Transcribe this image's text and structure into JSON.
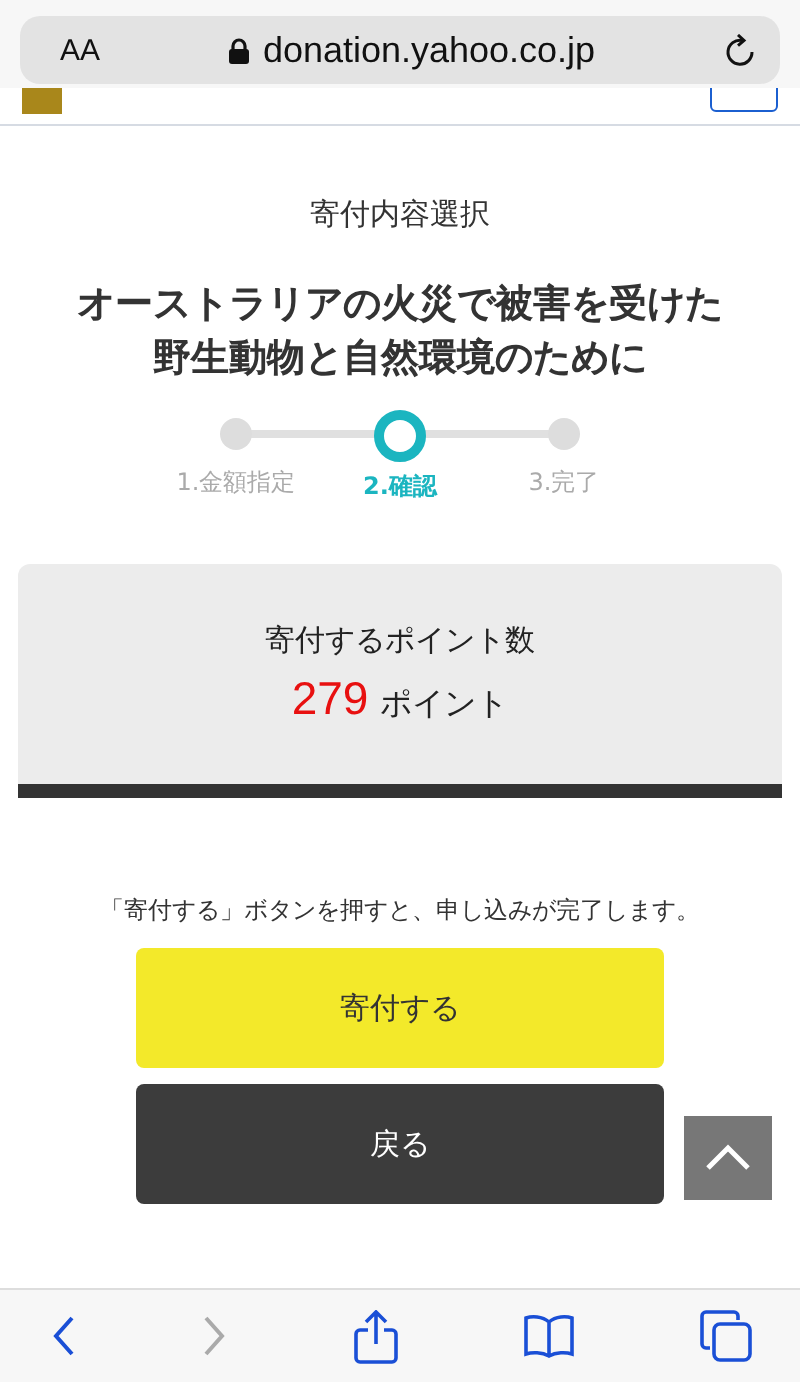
{
  "browser": {
    "text_size_label": "AA",
    "url": "donation.yahoo.co.jp"
  },
  "page": {
    "heading": "寄付内容選択",
    "title_lines": [
      "オーストラリアの火災で被害を受けた",
      "野生動物と自然環境のために"
    ]
  },
  "steps": [
    {
      "label": "1.金額指定",
      "selected": false
    },
    {
      "label": "2.確認",
      "selected": true
    },
    {
      "label": "3.完了",
      "selected": false
    }
  ],
  "points": {
    "label": "寄付するポイント数",
    "value": "279",
    "unit": "ポイント"
  },
  "note": "「寄付する」ボタンを押すと、申し込みが完了します。",
  "buttons": [
    {
      "kind": "primary",
      "label": "寄付する"
    },
    {
      "kind": "secondary",
      "label": "戻る"
    }
  ],
  "toolbar": {
    "back_disabled": false,
    "forward_disabled": true
  }
}
